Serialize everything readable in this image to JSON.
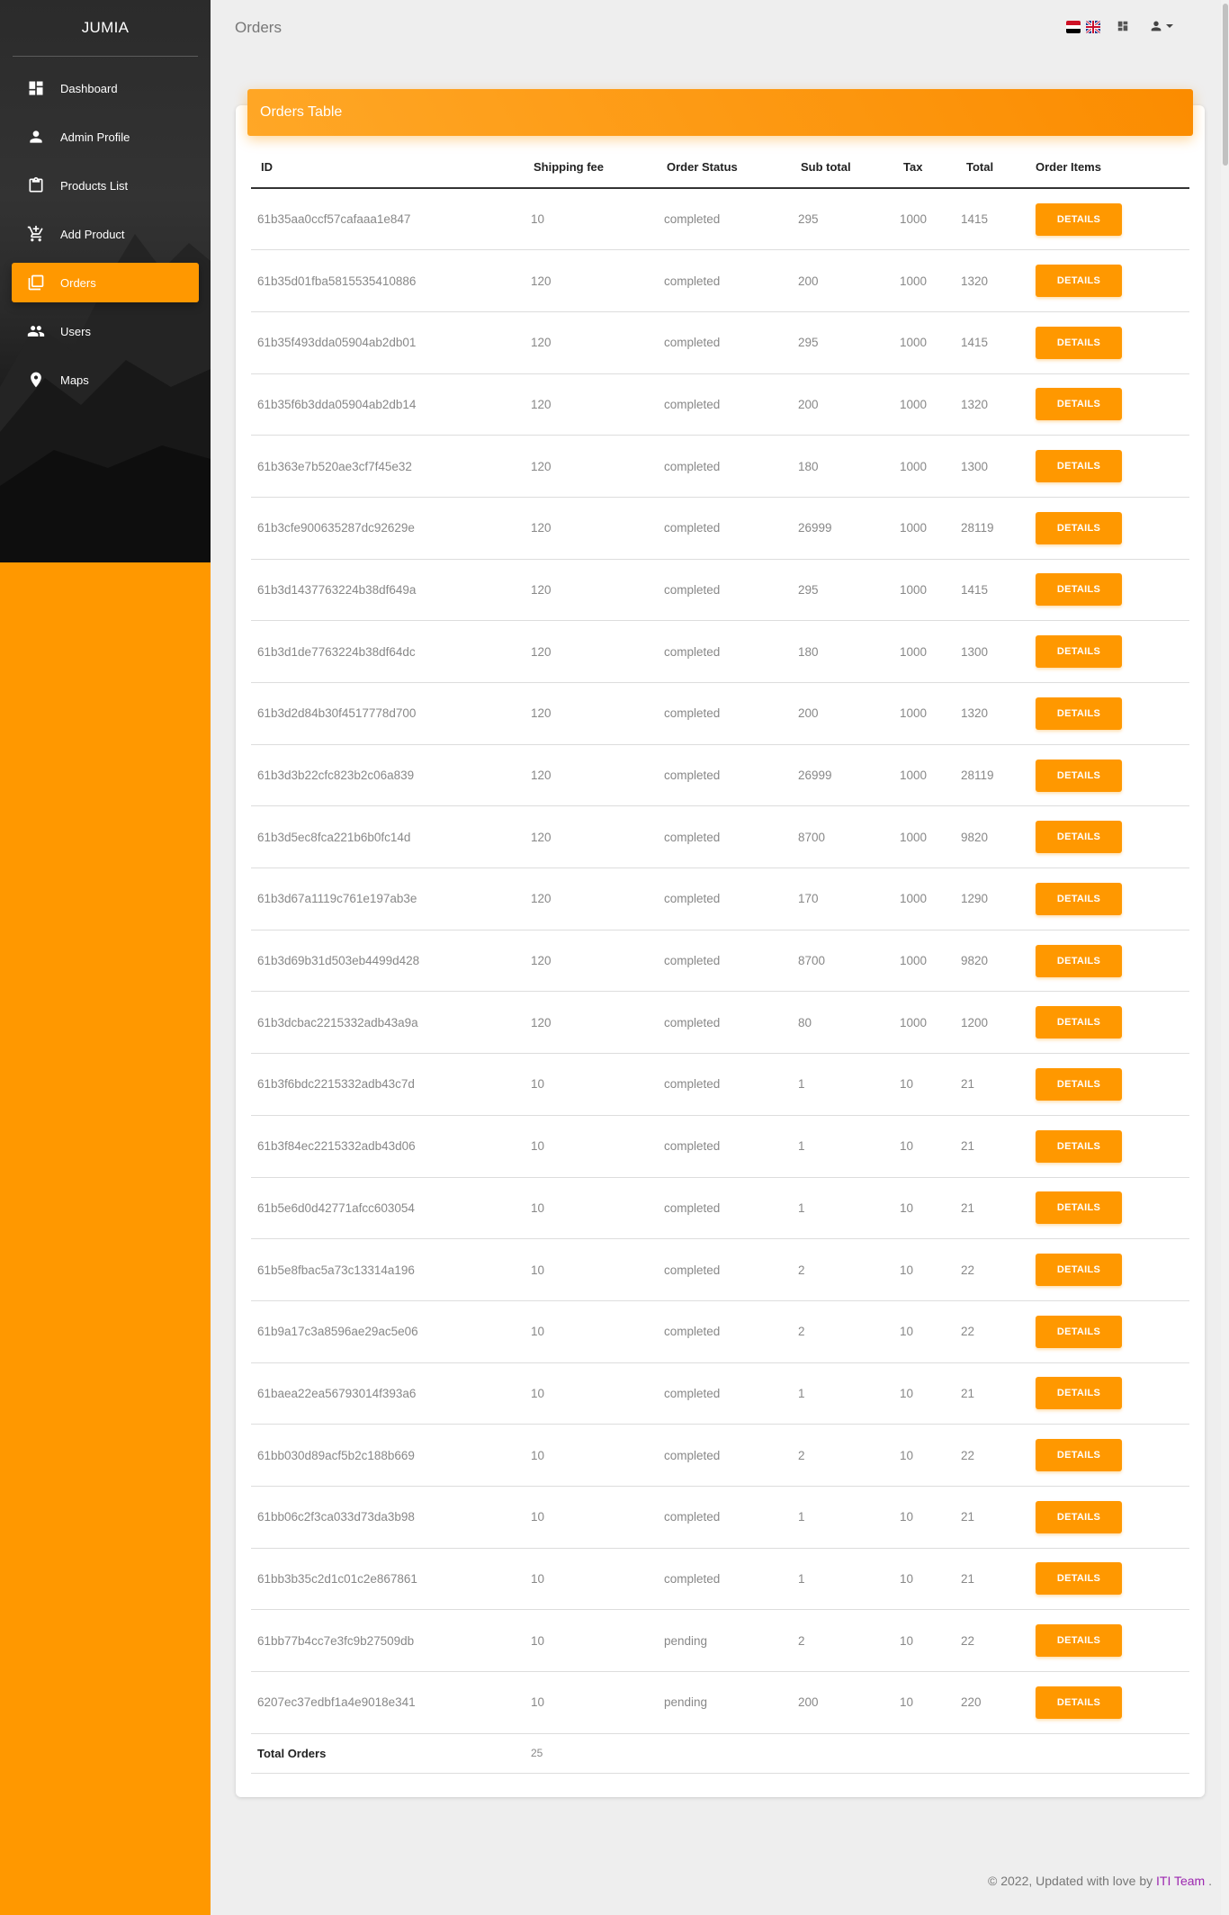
{
  "app": {
    "brand": "JUMIA"
  },
  "sidebar": {
    "items": [
      {
        "label": "Dashboard",
        "icon": "dashboard-icon",
        "active": false
      },
      {
        "label": "Admin Profile",
        "icon": "person-icon",
        "active": false
      },
      {
        "label": "Products List",
        "icon": "clipboard-icon",
        "active": false
      },
      {
        "label": "Add Product",
        "icon": "add-cart-icon",
        "active": false
      },
      {
        "label": "Orders",
        "icon": "library-icon",
        "active": true
      },
      {
        "label": "Users",
        "icon": "people-icon",
        "active": false
      },
      {
        "label": "Maps",
        "icon": "location-pin-icon",
        "active": false
      }
    ]
  },
  "header": {
    "title": "Orders"
  },
  "card": {
    "title": "Orders Table"
  },
  "table": {
    "columns": [
      "ID",
      "Shipping fee",
      "Order Status",
      "Sub total",
      "Tax",
      "Total",
      "Order Items"
    ],
    "button_label": "DETAILS",
    "rows": [
      [
        "61b35aa0ccf57cafaaa1e847",
        "10",
        "completed",
        "295",
        "1000",
        "1415"
      ],
      [
        "61b35d01fba5815535410886",
        "120",
        "completed",
        "200",
        "1000",
        "1320"
      ],
      [
        "61b35f493dda05904ab2db01",
        "120",
        "completed",
        "295",
        "1000",
        "1415"
      ],
      [
        "61b35f6b3dda05904ab2db14",
        "120",
        "completed",
        "200",
        "1000",
        "1320"
      ],
      [
        "61b363e7b520ae3cf7f45e32",
        "120",
        "completed",
        "180",
        "1000",
        "1300"
      ],
      [
        "61b3cfe900635287dc92629e",
        "120",
        "completed",
        "26999",
        "1000",
        "28119"
      ],
      [
        "61b3d1437763224b38df649a",
        "120",
        "completed",
        "295",
        "1000",
        "1415"
      ],
      [
        "61b3d1de7763224b38df64dc",
        "120",
        "completed",
        "180",
        "1000",
        "1300"
      ],
      [
        "61b3d2d84b30f4517778d700",
        "120",
        "completed",
        "200",
        "1000",
        "1320"
      ],
      [
        "61b3d3b22cfc823b2c06a839",
        "120",
        "completed",
        "26999",
        "1000",
        "28119"
      ],
      [
        "61b3d5ec8fca221b6b0fc14d",
        "120",
        "completed",
        "8700",
        "1000",
        "9820"
      ],
      [
        "61b3d67a1119c761e197ab3e",
        "120",
        "completed",
        "170",
        "1000",
        "1290"
      ],
      [
        "61b3d69b31d503eb4499d428",
        "120",
        "completed",
        "8700",
        "1000",
        "9820"
      ],
      [
        "61b3dcbac2215332adb43a9a",
        "120",
        "completed",
        "80",
        "1000",
        "1200"
      ],
      [
        "61b3f6bdc2215332adb43c7d",
        "10",
        "completed",
        "1",
        "10",
        "21"
      ],
      [
        "61b3f84ec2215332adb43d06",
        "10",
        "completed",
        "1",
        "10",
        "21"
      ],
      [
        "61b5e6d0d42771afcc603054",
        "10",
        "completed",
        "1",
        "10",
        "21"
      ],
      [
        "61b5e8fbac5a73c13314a196",
        "10",
        "completed",
        "2",
        "10",
        "22"
      ],
      [
        "61b9a17c3a8596ae29ac5e06",
        "10",
        "completed",
        "2",
        "10",
        "22"
      ],
      [
        "61baea22ea56793014f393a6",
        "10",
        "completed",
        "1",
        "10",
        "21"
      ],
      [
        "61bb030d89acf5b2c188b669",
        "10",
        "completed",
        "2",
        "10",
        "22"
      ],
      [
        "61bb06c2f3ca033d73da3b98",
        "10",
        "completed",
        "1",
        "10",
        "21"
      ],
      [
        "61bb3b35c2d1c01c2e867861",
        "10",
        "completed",
        "1",
        "10",
        "21"
      ],
      [
        "61bb77b4cc7e3fc9b27509db",
        "10",
        "pending",
        "2",
        "10",
        "22"
      ],
      [
        "6207ec37edbf1a4e9018e341",
        "10",
        "pending",
        "200",
        "10",
        "220"
      ]
    ],
    "total_label": "Total Orders",
    "total_value": "25"
  },
  "footer": {
    "text": "© 2022, Updated with love by ",
    "team": "ITI Team",
    "suffix": " ."
  },
  "colors": {
    "accent": "#ff9800",
    "footer_link": "#9c27b0"
  }
}
